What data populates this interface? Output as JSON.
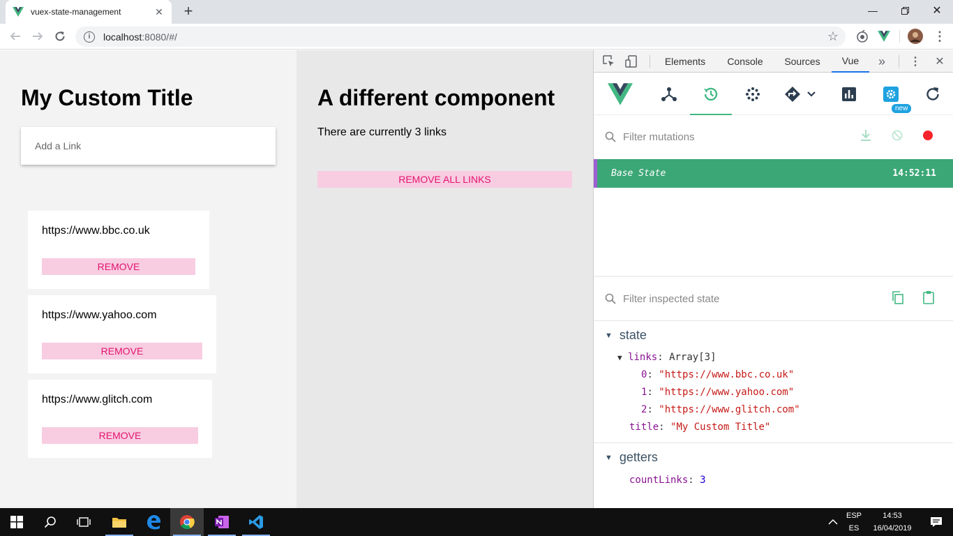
{
  "browser": {
    "tab_title": "vuex-state-management",
    "url_host": "localhost",
    "url_rest": ":8080/#/"
  },
  "app": {
    "left": {
      "title": "My Custom Title",
      "add_link_placeholder": "Add a Link",
      "links": [
        {
          "url": "https://www.bbc.co.uk",
          "remove_label": "REMOVE"
        },
        {
          "url": "https://www.yahoo.com",
          "remove_label": "REMOVE"
        },
        {
          "url": "https://www.glitch.com",
          "remove_label": "REMOVE"
        }
      ]
    },
    "right": {
      "title": "A different component",
      "count_text": "There are currently 3 links",
      "remove_all_label": "REMOVE ALL LINKS"
    }
  },
  "devtools": {
    "tabs": [
      "Elements",
      "Console",
      "Sources",
      "Vue"
    ],
    "active_tab": "Vue",
    "vue_toolbar_icons": [
      "vue-logo-icon",
      "components-icon",
      "vuex-history-icon",
      "events-icon",
      "routing-icon",
      "performance-icon",
      "settings-icon",
      "refresh-icon"
    ],
    "new_badge": "new",
    "filter_mutations_placeholder": "Filter mutations",
    "mutation": {
      "name": "Base State",
      "time": "14:52:11"
    },
    "filter_state_placeholder": "Filter inspected state",
    "state_label": "state",
    "state": {
      "links_key": "links",
      "links_type": "Array[3]",
      "items": [
        {
          "index": "0",
          "value": "\"https://www.bbc.co.uk\""
        },
        {
          "index": "1",
          "value": "\"https://www.yahoo.com\""
        },
        {
          "index": "2",
          "value": "\"https://www.glitch.com\""
        }
      ],
      "title_key": "title",
      "title_value": "\"My Custom Title\""
    },
    "getters_label": "getters",
    "getters": {
      "key": "countLinks",
      "value": "3"
    }
  },
  "taskbar": {
    "lang_top": "ESP",
    "lang_bottom": "ES",
    "time": "14:53",
    "date": "16/04/2019"
  },
  "colors": {
    "vue_green": "#42b883",
    "mutation_row": "#3ba776",
    "remove_bg": "#f8cde1",
    "remove_text": "#e2136e"
  }
}
